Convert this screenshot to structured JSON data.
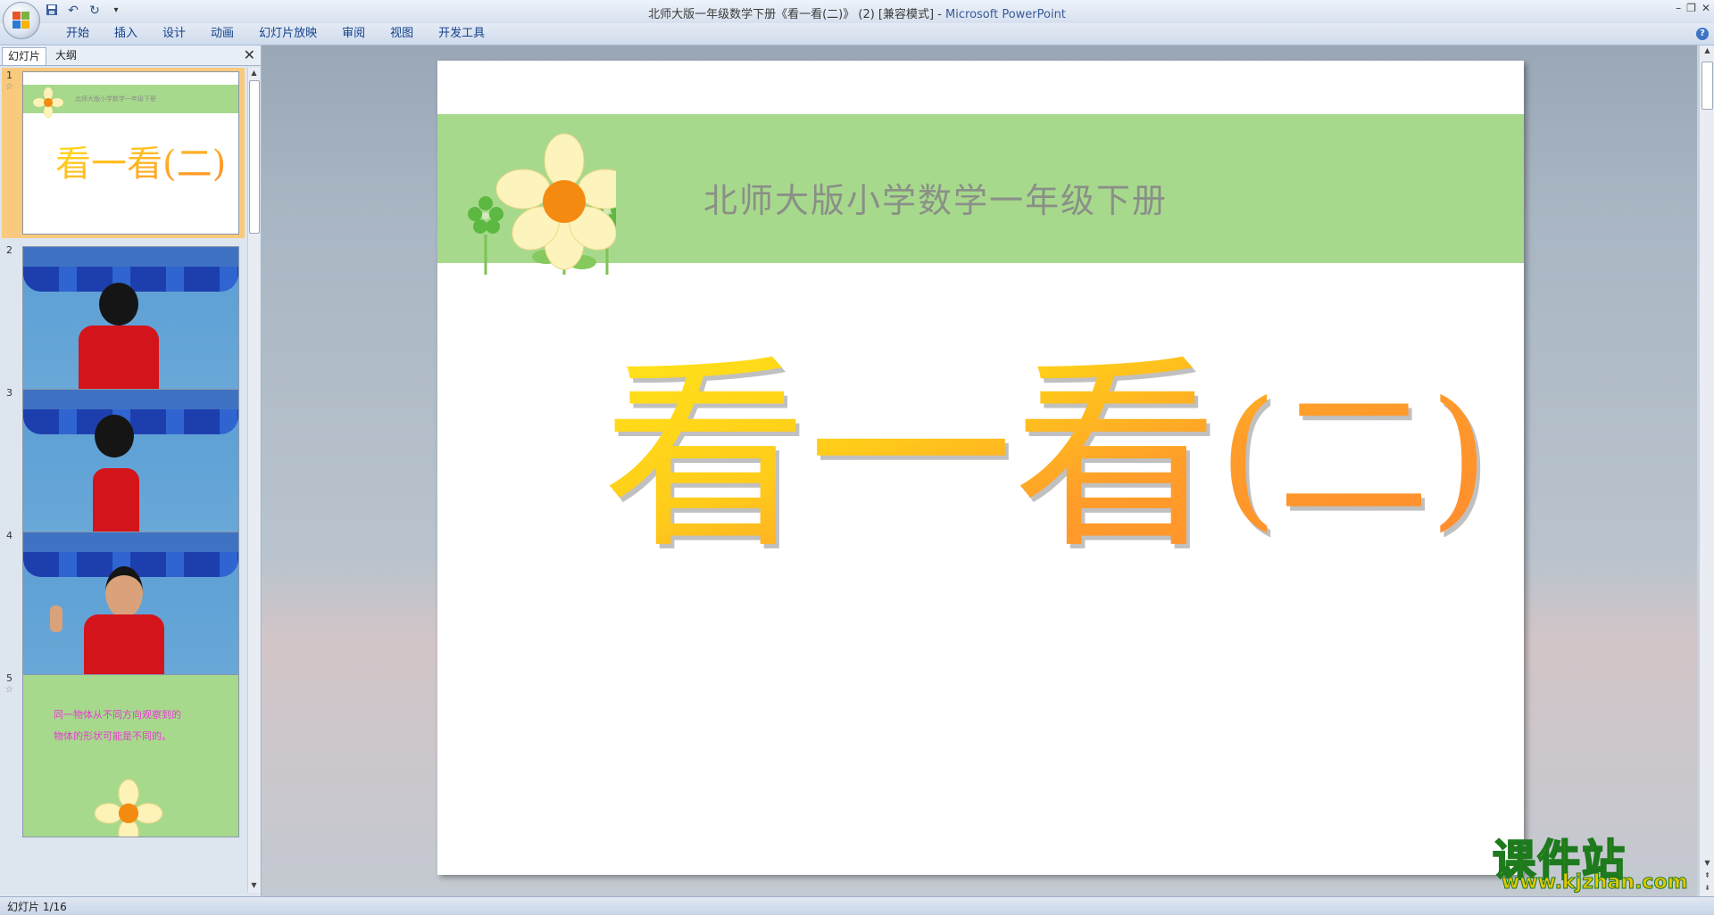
{
  "window": {
    "title": "北师大版一年级数学下册《看一看(二)》 (2) [兼容模式] - ",
    "app_name": "Microsoft PowerPoint",
    "controls": [
      "–",
      "❐",
      "✕"
    ]
  },
  "qat": {
    "save_icon": "save-icon",
    "undo_icon": "undo-icon",
    "redo_icon": "redo-icon",
    "customize": "▾"
  },
  "ribbon": {
    "tabs": [
      "开始",
      "插入",
      "设计",
      "动画",
      "幻灯片放映",
      "审阅",
      "视图",
      "开发工具"
    ],
    "help": "?"
  },
  "left_pane": {
    "tabs": {
      "slides": "幻灯片",
      "outline": "大纲"
    },
    "close": "✕",
    "thumbnails": [
      {
        "number": "1",
        "subtitle": "北师大版小学数学一年级下册",
        "title": "看一看(二)",
        "selected": true,
        "animated": true
      },
      {
        "number": "2",
        "content": "photo-back"
      },
      {
        "number": "3",
        "content": "photo-side"
      },
      {
        "number": "4",
        "content": "photo-front"
      },
      {
        "number": "5",
        "lines": [
          "同一物体从不同方向观察到的",
          "物体的形状可能是不同的。"
        ],
        "animated": true
      }
    ]
  },
  "slide": {
    "subtitle": "北师大版小学数学一年级下册",
    "title_main": "看一看",
    "title_paren": "(二)",
    "band_color": "#a7d98d"
  },
  "status": {
    "text": "幻灯片 1/16"
  },
  "watermark": {
    "text": "课件站",
    "url": "www.kjzhan.com"
  }
}
